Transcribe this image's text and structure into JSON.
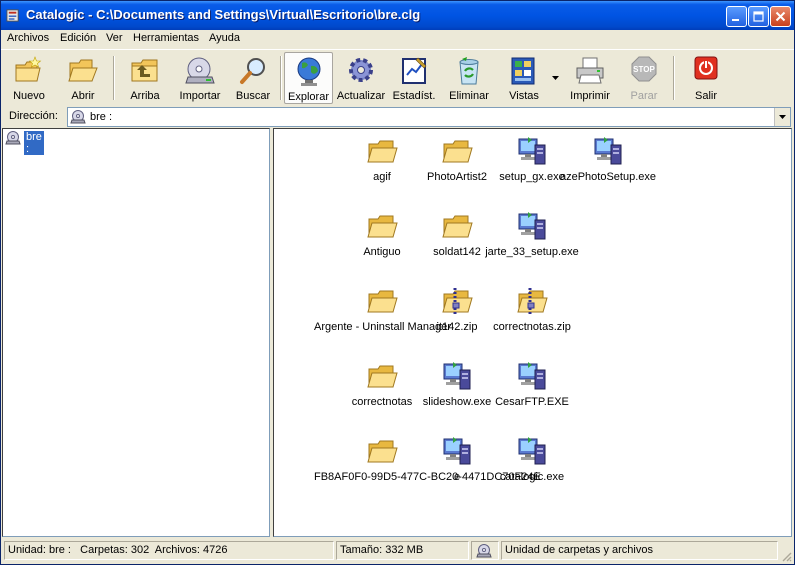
{
  "window": {
    "title": "Catalogic - C:\\Documents and Settings\\Virtual\\Escritorio\\bre.clg",
    "icon": "catalogic-app-icon",
    "controls": [
      "minimize-icon",
      "maximize-icon",
      "close-icon"
    ]
  },
  "menu": {
    "items": [
      "Archivos",
      "Edición",
      "Ver",
      "Herramientas",
      "Ayuda"
    ]
  },
  "toolbar": {
    "items": [
      {
        "label": "Nuevo",
        "icon": "new-folder-icon"
      },
      {
        "label": "Abrir",
        "icon": "open-folder-icon"
      },
      {
        "label": "Arriba",
        "icon": "up-folder-icon"
      },
      {
        "label": "Importar",
        "icon": "import-disc-icon"
      },
      {
        "label": "Buscar",
        "icon": "magnifier-icon"
      },
      {
        "label": "Explorar",
        "icon": "globe-icon",
        "active": true
      },
      {
        "label": "Actualizar",
        "icon": "gear-icon"
      },
      {
        "label": "Estadíst.",
        "icon": "statistics-icon"
      },
      {
        "label": "Eliminar",
        "icon": "recycle-bin-icon"
      },
      {
        "label": "Vistas",
        "icon": "views-icon"
      },
      {
        "label": "Imprimir",
        "icon": "printer-icon"
      },
      {
        "label": "Parar",
        "icon": "stop-icon",
        "disabled": true,
        "stop_text": "STOP"
      },
      {
        "label": "Salir",
        "icon": "power-icon"
      }
    ]
  },
  "address": {
    "label": "Dirección:",
    "value": "bre :"
  },
  "tree": {
    "items": [
      {
        "label": "bre :",
        "icon": "disc-drive-icon",
        "selected": true
      }
    ]
  },
  "files": {
    "items": [
      {
        "name": "agif",
        "type": "folder"
      },
      {
        "name": "PhotoArtist2",
        "type": "folder"
      },
      {
        "name": "setup_gx.exe",
        "type": "exe"
      },
      {
        "name": "azePhotoSetup.exe",
        "type": "exe"
      },
      {
        "name": "Antiguo",
        "type": "folder"
      },
      {
        "name": "soldat142",
        "type": "folder"
      },
      {
        "name": "jarte_33_setup.exe",
        "type": "exe"
      },
      {
        "name": "Argente - Uninstall Manager",
        "type": "folder"
      },
      {
        "name": "it142.zip",
        "type": "zip"
      },
      {
        "name": "correctnotas.zip",
        "type": "zip"
      },
      {
        "name": "correctnotas",
        "type": "folder"
      },
      {
        "name": "slideshow.exe",
        "type": "exe"
      },
      {
        "name": "CesarFTP.EXE",
        "type": "exe"
      },
      {
        "name": "FB8AF0F0-99D5-477C-BC20-4471DC70F24E",
        "type": "folder"
      },
      {
        "name": "e",
        "type": "exe"
      },
      {
        "name": "catalogic.exe",
        "type": "exe"
      }
    ]
  },
  "status": {
    "unit": "Unidad: bre :   Carpetas: 302  Archivos: 4726",
    "size": "Tamaño: 332 MB",
    "description": "Unidad de carpetas y archivos"
  },
  "colors": {
    "titlebar": "#0054e3",
    "selection": "#316ac5",
    "folder": "#f5d36b"
  }
}
